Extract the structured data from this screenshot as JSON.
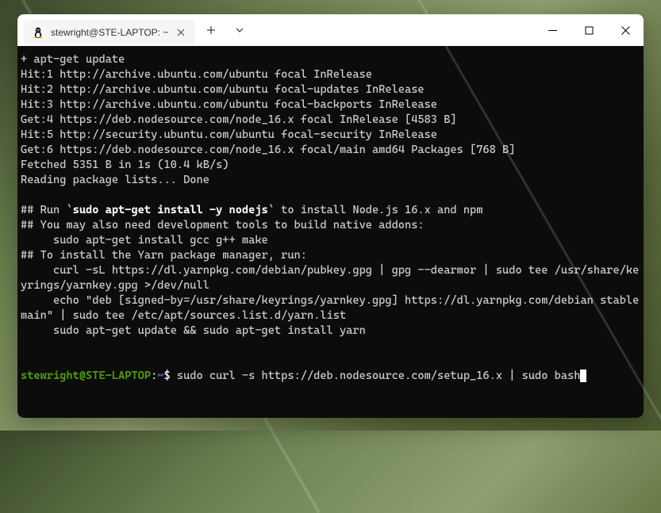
{
  "tab": {
    "title": "stewright@STE-LAPTOP: ~"
  },
  "output": {
    "l1": "+ apt-get update",
    "l2": "Hit:1 http://archive.ubuntu.com/ubuntu focal InRelease",
    "l3": "Hit:2 http://archive.ubuntu.com/ubuntu focal-updates InRelease",
    "l4": "Hit:3 http://archive.ubuntu.com/ubuntu focal-backports InRelease",
    "l5": "Get:4 https://deb.nodesource.com/node_16.x focal InRelease [4583 B]",
    "l6": "Hit:5 http://security.ubuntu.com/ubuntu focal-security InRelease",
    "l7": "Get:6 https://deb.nodesource.com/node_16.x focal/main amd64 Packages [768 B]",
    "l8": "Fetched 5351 B in 1s (10.4 kB/s)",
    "l9": "Reading package lists... Done",
    "l10": "",
    "run_prefix": "## Run `",
    "run_cmd": "sudo apt-get install -y nodejs",
    "run_suffix": "` to install Node.js 16.x and npm",
    "l12": "## You may also need development tools to build native addons:",
    "l13": "     sudo apt-get install gcc g++ make",
    "l14": "## To install the Yarn package manager, run:",
    "l15": "     curl -sL https://dl.yarnpkg.com/debian/pubkey.gpg | gpg --dearmor | sudo tee /usr/share/keyrings/yarnkey.gpg >/dev/null",
    "l16": "     echo \"deb [signed-by=/usr/share/keyrings/yarnkey.gpg] https://dl.yarnpkg.com/debian stable main\" | sudo tee /etc/apt/sources.list.d/yarn.list",
    "l17": "     sudo apt-get update && sudo apt-get install yarn",
    "l18": "",
    "l19": ""
  },
  "prompt": {
    "user_host": "stewright@STE-LAPTOP",
    "colon": ":",
    "path": "~",
    "dollar": "$ ",
    "command": "sudo curl -s https://deb.nodesource.com/setup_16.x | sudo bash"
  }
}
